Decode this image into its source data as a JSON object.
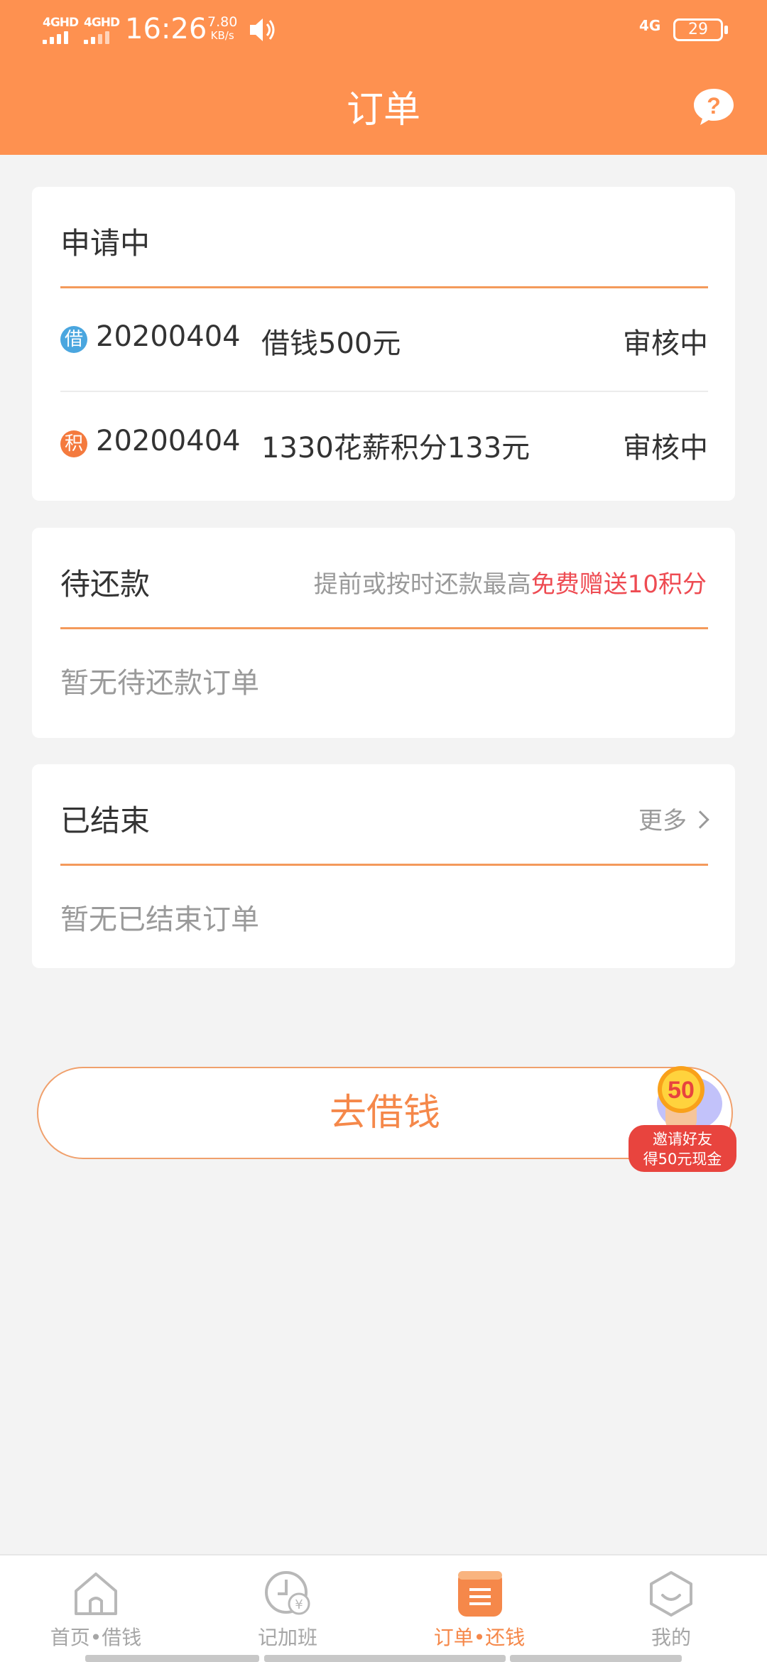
{
  "status_bar": {
    "signal1": "4GHD",
    "signal2": "4GHD",
    "time": "16:26",
    "speed_value": "7.80",
    "speed_unit": "KB/s",
    "network": "4G",
    "battery": "29"
  },
  "header": {
    "title": "订单",
    "help_icon": "question-icon"
  },
  "applying": {
    "title": "申请中",
    "rows": [
      {
        "badge": "借",
        "badge_color": "#4aa6df",
        "order_no": "20200404",
        "desc": "借钱500元",
        "status": "审核中"
      },
      {
        "badge": "积",
        "badge_color": "#f47a3e",
        "order_no": "20200404",
        "desc": "1330花薪积分133元",
        "status": "审核中"
      }
    ]
  },
  "pending_repay": {
    "title": "待还款",
    "promo_text": "提前或按时还款最高",
    "promo_highlight": "免费赠送10积分",
    "empty_text": "暂无待还款订单"
  },
  "finished": {
    "title": "已结束",
    "more_label": "更多",
    "empty_text": "暂无已结束订单"
  },
  "borrow_button": {
    "label": "去借钱"
  },
  "invite": {
    "coin_value": "50",
    "line1": "邀请好友",
    "line2": "得50元现金"
  },
  "tabbar": {
    "tabs": [
      {
        "label": "首页•借钱",
        "icon": "home-icon",
        "active": false
      },
      {
        "label": "记加班",
        "icon": "clock-yen-icon",
        "active": false
      },
      {
        "label": "订单•还钱",
        "icon": "order-list-icon",
        "active": true
      },
      {
        "label": "我的",
        "icon": "smiley-icon",
        "active": false
      }
    ]
  },
  "colors": {
    "brand": "#fe9150",
    "accent_text": "#f5884a",
    "highlight_red": "#ee4b52"
  }
}
